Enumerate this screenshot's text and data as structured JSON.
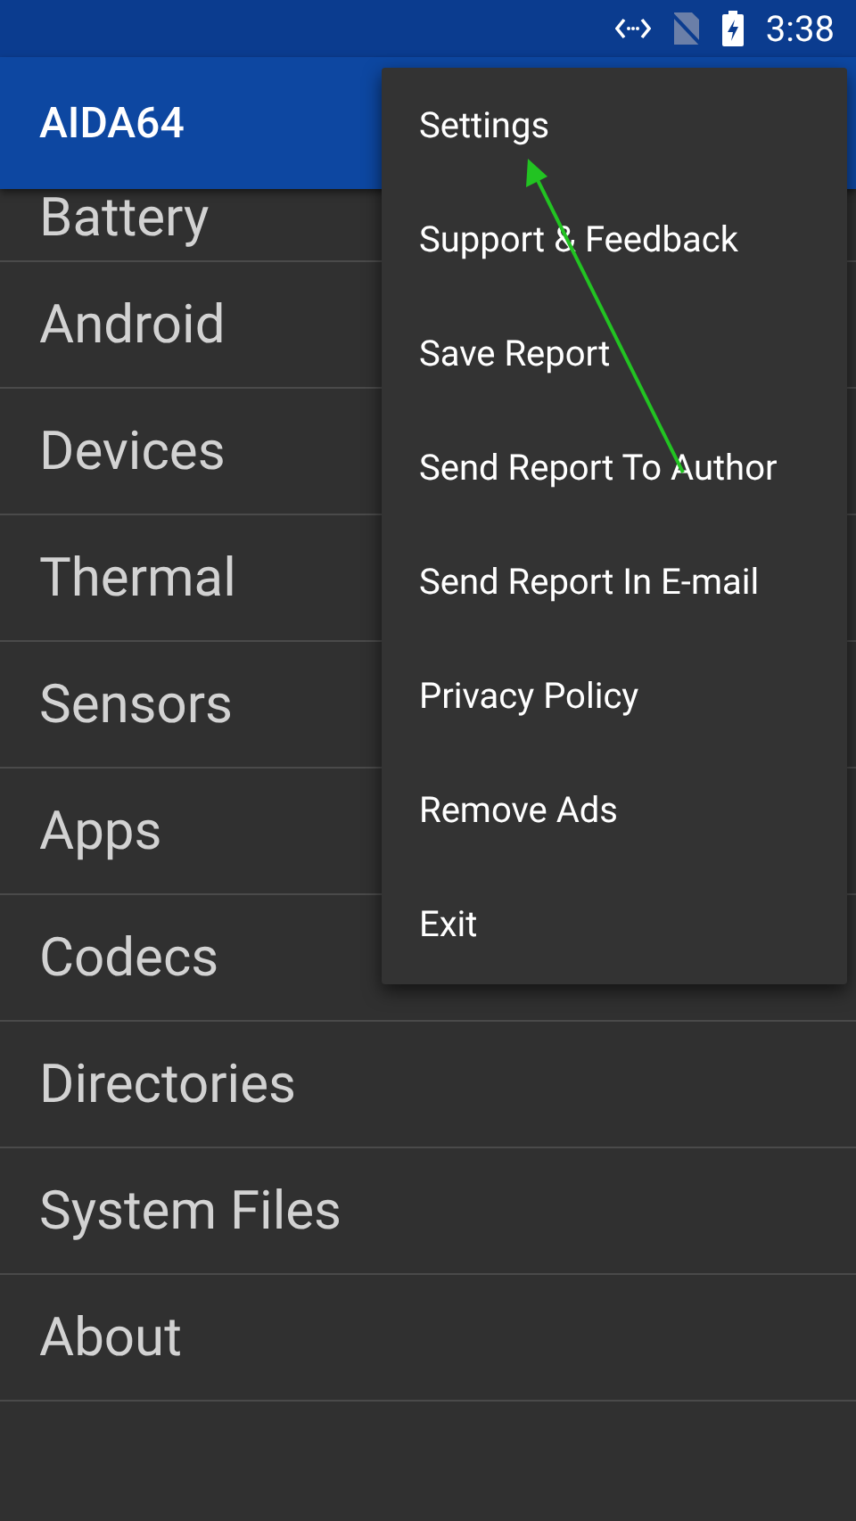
{
  "status_bar": {
    "time": "3:38"
  },
  "app_bar": {
    "title": "AIDA64"
  },
  "categories": [
    {
      "label": "Battery"
    },
    {
      "label": "Android"
    },
    {
      "label": "Devices"
    },
    {
      "label": "Thermal"
    },
    {
      "label": "Sensors"
    },
    {
      "label": "Apps"
    },
    {
      "label": "Codecs"
    },
    {
      "label": "Directories"
    },
    {
      "label": "System Files"
    },
    {
      "label": "About"
    }
  ],
  "menu": {
    "items": [
      {
        "label": "Settings"
      },
      {
        "label": "Support & Feedback"
      },
      {
        "label": "Save Report"
      },
      {
        "label": "Send Report To Author"
      },
      {
        "label": "Send Report In E-mail"
      },
      {
        "label": "Privacy Policy"
      },
      {
        "label": "Remove Ads"
      },
      {
        "label": "Exit"
      }
    ]
  }
}
